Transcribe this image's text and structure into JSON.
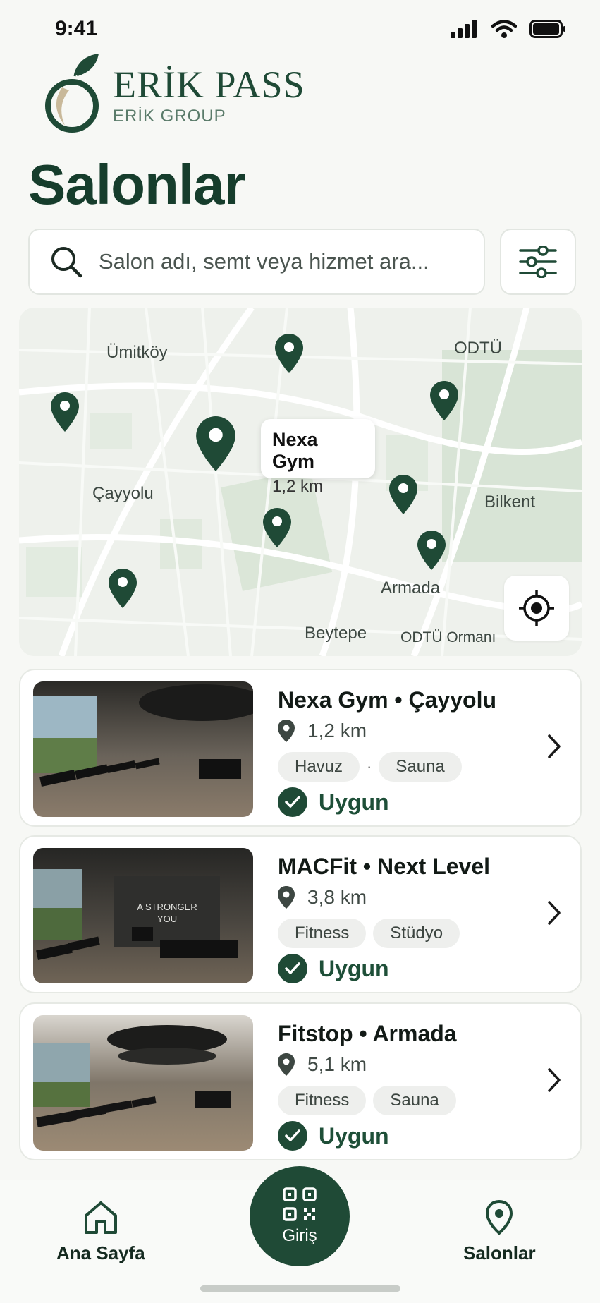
{
  "status": {
    "time": "9:41"
  },
  "brand": {
    "name": "ERİK PASS",
    "subtitle": "ERİK GROUP"
  },
  "page": {
    "title": "Salonlar"
  },
  "search": {
    "placeholder": "Salon adı, semt veya hizmet ara..."
  },
  "map": {
    "labels": [
      "Ümitköy",
      "ODTÜ",
      "Çayyolu",
      "Bilkent",
      "Armada",
      "Beytepe",
      "ODTÜ Ormanı"
    ],
    "popup": {
      "name": "Nexa Gym",
      "distance": "1,2 km"
    }
  },
  "gyms": [
    {
      "title": "Nexa Gym • Çayyolu",
      "distance": "1,2 km",
      "tags": [
        "Havuz",
        "Sauna"
      ],
      "status": "Uygun"
    },
    {
      "title": "MACFit • Next Level",
      "distance": "3,8 km",
      "tags": [
        "Fitness",
        "Stüdyo"
      ],
      "status": "Uygun",
      "wall_text": "A STRONGER YOU"
    },
    {
      "title": "Fitstop • Armada",
      "distance": "5,1 km",
      "tags": [
        "Fitness",
        "Sauna"
      ],
      "status": "Uygun"
    }
  ],
  "nav": {
    "home": "Ana Sayfa",
    "checkin": "Giriş",
    "gyms": "Salonlar"
  },
  "colors": {
    "primary": "#1f4a36",
    "background": "#f7f8f5",
    "map": "#eef1ec"
  },
  "icons": [
    "search-icon",
    "filter-icon",
    "map-pin-icon",
    "locate-icon",
    "check-icon",
    "chevron-right-icon",
    "home-icon",
    "qr-icon",
    "location-icon"
  ]
}
